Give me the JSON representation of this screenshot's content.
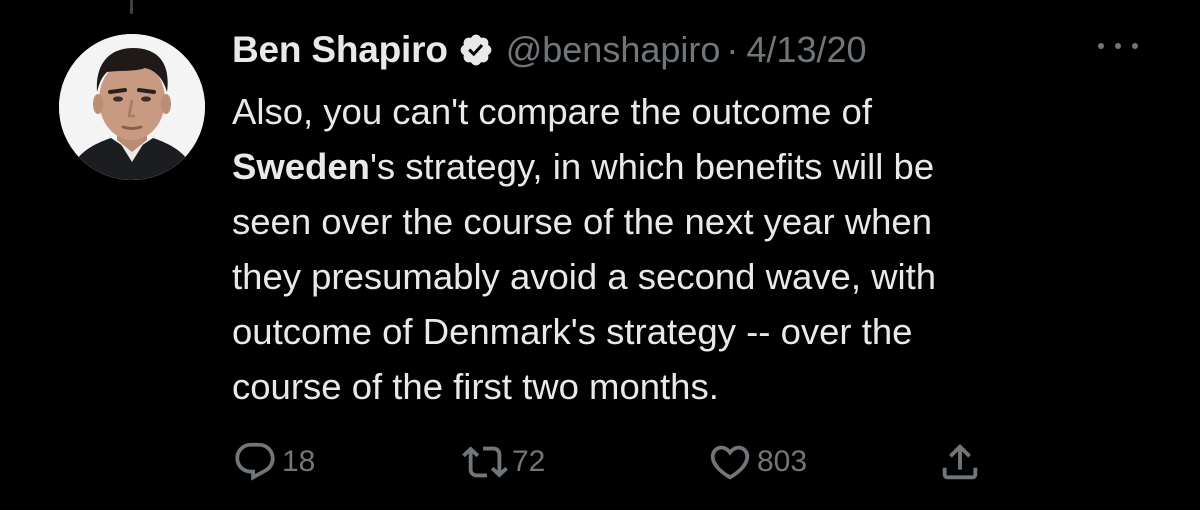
{
  "author": {
    "display_name": "Ben Shapiro",
    "handle": "@benshapiro",
    "separator": "·",
    "date": "4/13/20",
    "verified_icon": "verified-badge-icon"
  },
  "menu": {
    "more_icon": "more-options-icon"
  },
  "tweet": {
    "lines": [
      [
        "",
        "Also, you can't compare the outcome of",
        ""
      ],
      [
        "Sweden",
        "'s strategy, in which benefits will be",
        ""
      ],
      [
        "",
        "seen over the course of the next year when",
        ""
      ],
      [
        "",
        "they presumably avoid a second wave, with",
        ""
      ],
      [
        "",
        "outcome of Denmark's strategy -- over the",
        ""
      ],
      [
        "",
        "course of the first two months.",
        ""
      ]
    ]
  },
  "actions": {
    "reply_count": "18",
    "retweet_count": "72",
    "like_count": "803",
    "share_label": ""
  },
  "colors": {
    "background": "#000000",
    "primary_text": "#e7e9ea",
    "secondary_text": "#71767b"
  }
}
